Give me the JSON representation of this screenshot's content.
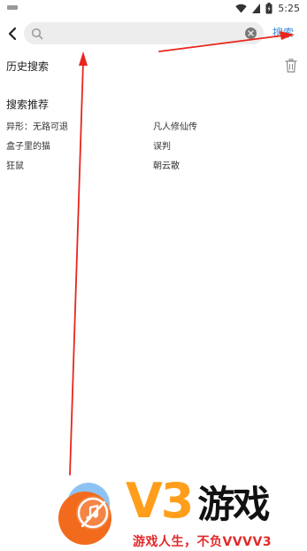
{
  "status_bar": {
    "time": "5:25",
    "icons": [
      "notification-icon",
      "wifi-icon",
      "battery-icon"
    ]
  },
  "search": {
    "placeholder": "",
    "value": "",
    "submit_label": "搜索",
    "icons": [
      "back-arrow-icon",
      "search-icon",
      "clear-icon"
    ]
  },
  "history": {
    "title": "历史搜索",
    "clear_icon": "trash-icon"
  },
  "recommend": {
    "title": "搜索推荐",
    "items": [
      "异形：无路可退",
      "凡人修仙传",
      "盒子里的猫",
      "误判",
      "狂鼠",
      "朝云散"
    ]
  },
  "watermark": {
    "brand": "V3游戏",
    "slogan": "游戏人生，不负VVVV3"
  },
  "colors": {
    "accent": "#3d8bd9",
    "annotation_arrow": "#e8261c",
    "watermark_orange": "#ff9e1b",
    "watermark_red": "#e02a2a"
  }
}
